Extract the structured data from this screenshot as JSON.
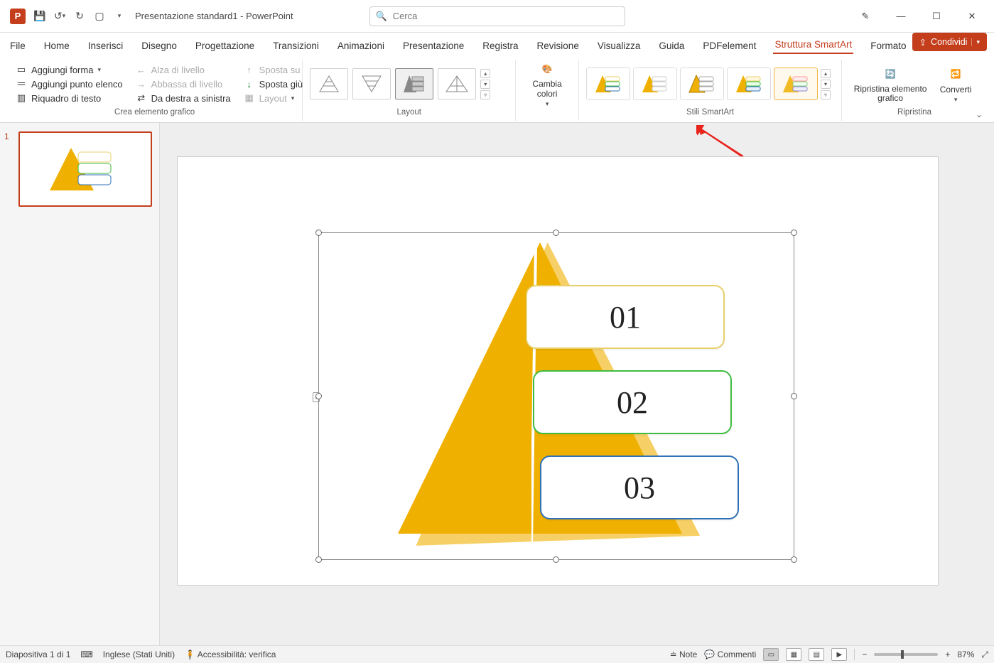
{
  "titlebar": {
    "app_letter": "P",
    "doc_title": "Presentazione standard1  -  PowerPoint",
    "search_placeholder": "Cerca"
  },
  "tabs": {
    "items": [
      "File",
      "Home",
      "Inserisci",
      "Disegno",
      "Progettazione",
      "Transizioni",
      "Animazioni",
      "Presentazione",
      "Registra",
      "Revisione",
      "Visualizza",
      "Guida",
      "PDFelement",
      "Struttura SmartArt",
      "Formato"
    ],
    "active": "Struttura SmartArt",
    "share": "Condividi"
  },
  "ribbon": {
    "group_crea": {
      "label": "Crea elemento grafico",
      "col1": {
        "add_shape": "Aggiungi forma",
        "add_bullet": "Aggiungi punto elenco",
        "text_pane": "Riquadro di testo"
      },
      "col2": {
        "promote": "Alza di livello",
        "demote": "Abbassa di livello",
        "rtl": "Da destra a sinistra"
      },
      "col3": {
        "move_up": "Sposta su",
        "move_down": "Sposta giù",
        "layout": "Layout"
      }
    },
    "group_layout": {
      "label": "Layout"
    },
    "group_colors": {
      "btn": "Cambia colori"
    },
    "group_styles": {
      "label": "Stili SmartArt"
    },
    "group_reset": {
      "label": "Ripristina",
      "reset": "Ripristina elemento grafico",
      "convert": "Converti"
    }
  },
  "slide_panel": {
    "num": "1"
  },
  "smartart": {
    "items": [
      "01",
      "02",
      "03"
    ]
  },
  "status": {
    "slide": "Diapositiva 1 di 1",
    "lang": "Inglese (Stati Uniti)",
    "access": "Accessibilità: verifica",
    "notes": "Note",
    "comments": "Commenti",
    "zoom_pct": "87%"
  }
}
